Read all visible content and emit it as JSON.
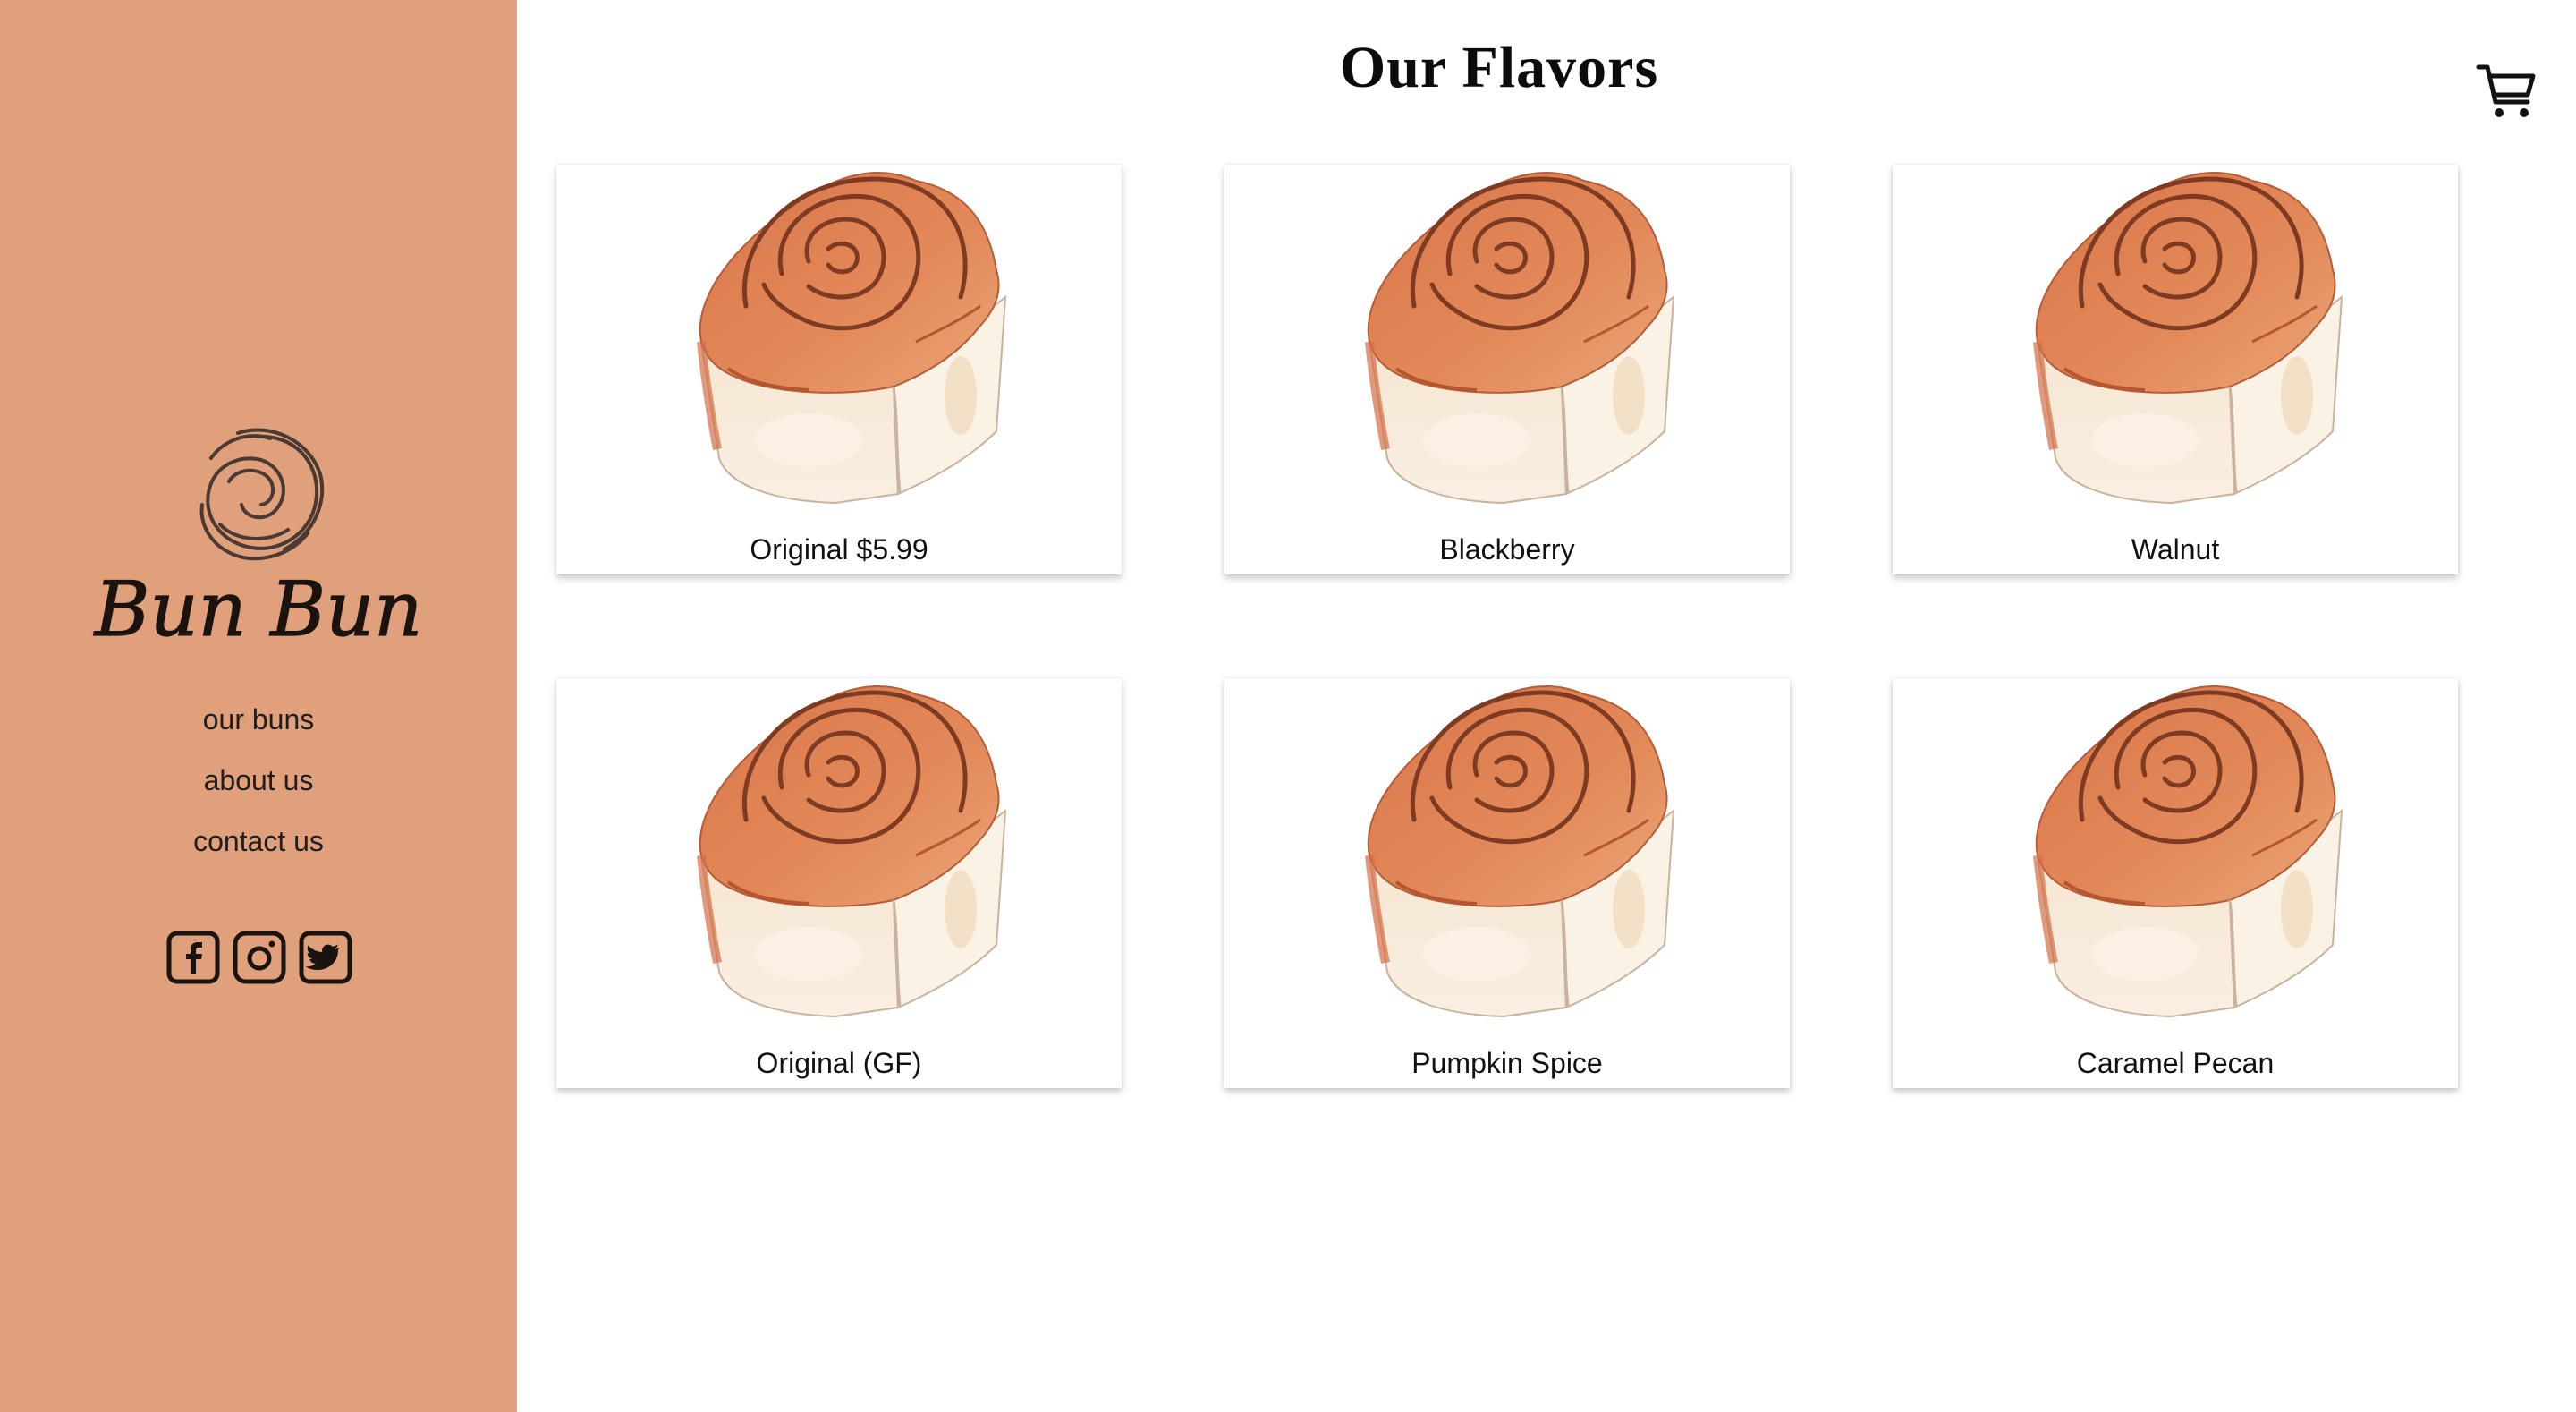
{
  "brand": {
    "name": "Bun Bun",
    "logo_icon": "swirl-logo-icon",
    "color": "#dfa07b"
  },
  "nav": {
    "items": [
      {
        "label": "our buns"
      },
      {
        "label": "about us"
      },
      {
        "label": "contact us"
      }
    ]
  },
  "social": {
    "icons": [
      "facebook-icon",
      "instagram-icon",
      "twitter-icon"
    ]
  },
  "header": {
    "title": "Our Flavors",
    "cart_icon": "cart-icon"
  },
  "products": [
    {
      "label": "Original $5.99"
    },
    {
      "label": "Blackberry"
    },
    {
      "label": "Walnut"
    },
    {
      "label": "Original (GF)"
    },
    {
      "label": "Pumpkin Spice"
    },
    {
      "label": "Caramel Pecan"
    }
  ]
}
